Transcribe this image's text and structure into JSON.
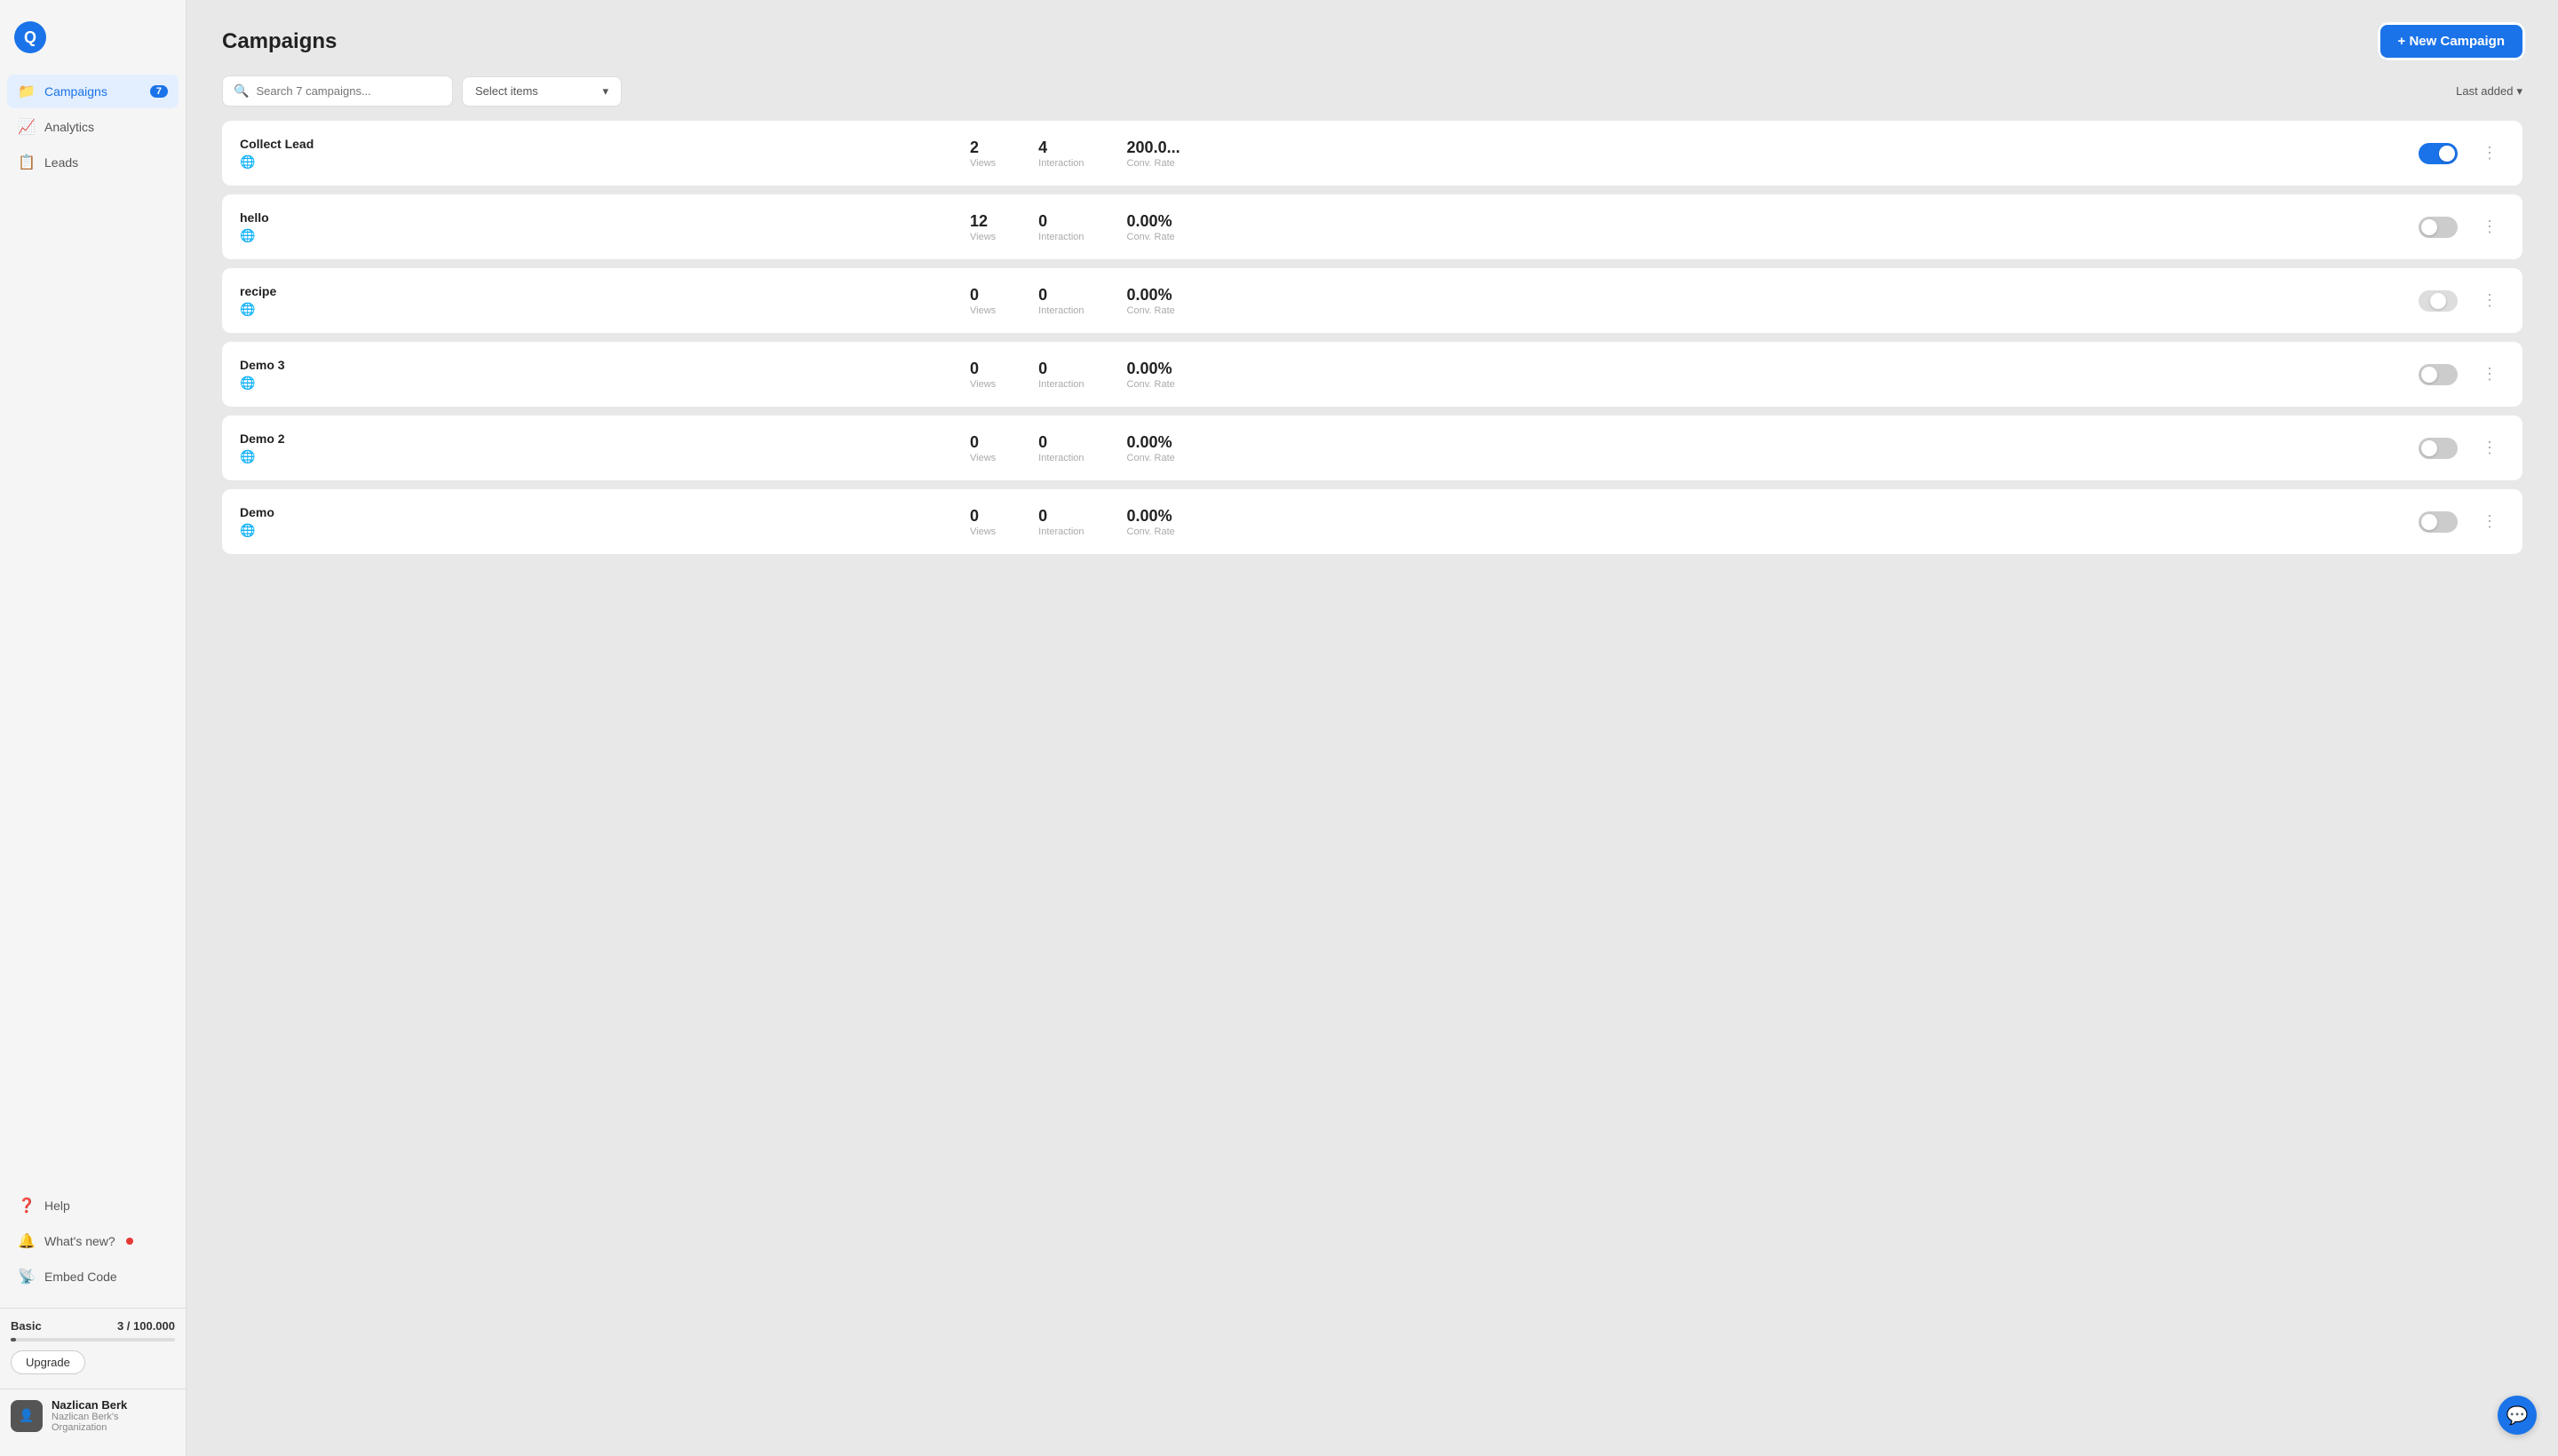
{
  "app": {
    "logo_text": "Q"
  },
  "sidebar": {
    "nav_items": [
      {
        "id": "campaigns",
        "label": "Campaigns",
        "icon": "📁",
        "active": true,
        "badge": "7"
      },
      {
        "id": "analytics",
        "label": "Analytics",
        "icon": "📈",
        "active": false,
        "badge": null
      },
      {
        "id": "leads",
        "label": "Leads",
        "icon": "📋",
        "active": false,
        "badge": null
      }
    ],
    "bottom_items": [
      {
        "id": "help",
        "label": "Help",
        "icon": "❓",
        "has_dot": false
      },
      {
        "id": "whats-new",
        "label": "What's new?",
        "icon": "🔔",
        "has_dot": true
      },
      {
        "id": "embed-code",
        "label": "Embed Code",
        "icon": "📡",
        "has_dot": false
      }
    ],
    "plan": {
      "name": "Basic",
      "usage": "3 / 100.000",
      "bar_percent": 3,
      "upgrade_label": "Upgrade"
    },
    "user": {
      "name": "Nazlican Berk",
      "org": "Nazlican Berk's Organization",
      "avatar_text": "👤"
    }
  },
  "header": {
    "title": "Campaigns",
    "new_campaign_label": "+ New Campaign"
  },
  "toolbar": {
    "search_placeholder": "Search 7 campaigns...",
    "select_placeholder": "Select items",
    "sort_label": "Last added",
    "sort_icon": "▾"
  },
  "campaigns": [
    {
      "id": 1,
      "name": "Collect Lead",
      "views": "2",
      "views_label": "Views",
      "interaction": "4",
      "interaction_label": "Interaction",
      "conv_rate": "200.0...",
      "conv_rate_label": "Conv. Rate",
      "toggle": "on"
    },
    {
      "id": 2,
      "name": "hello",
      "views": "12",
      "views_label": "Views",
      "interaction": "0",
      "interaction_label": "Interaction",
      "conv_rate": "0.00%",
      "conv_rate_label": "Conv. Rate",
      "toggle": "off"
    },
    {
      "id": 3,
      "name": "recipe",
      "views": "0",
      "views_label": "Views",
      "interaction": "0",
      "interaction_label": "Interaction",
      "conv_rate": "0.00%",
      "conv_rate_label": "Conv. Rate",
      "toggle": "disabled"
    },
    {
      "id": 4,
      "name": "Demo 3",
      "views": "0",
      "views_label": "Views",
      "interaction": "0",
      "interaction_label": "Interaction",
      "conv_rate": "0.00%",
      "conv_rate_label": "Conv. Rate",
      "toggle": "off"
    },
    {
      "id": 5,
      "name": "Demo 2",
      "views": "0",
      "views_label": "Views",
      "interaction": "0",
      "interaction_label": "Interaction",
      "conv_rate": "0.00%",
      "conv_rate_label": "Conv. Rate",
      "toggle": "off"
    },
    {
      "id": 6,
      "name": "Demo",
      "views": "0",
      "views_label": "Views",
      "interaction": "0",
      "interaction_label": "Interaction",
      "conv_rate": "0.00%",
      "conv_rate_label": "Conv. Rate",
      "toggle": "off"
    }
  ]
}
